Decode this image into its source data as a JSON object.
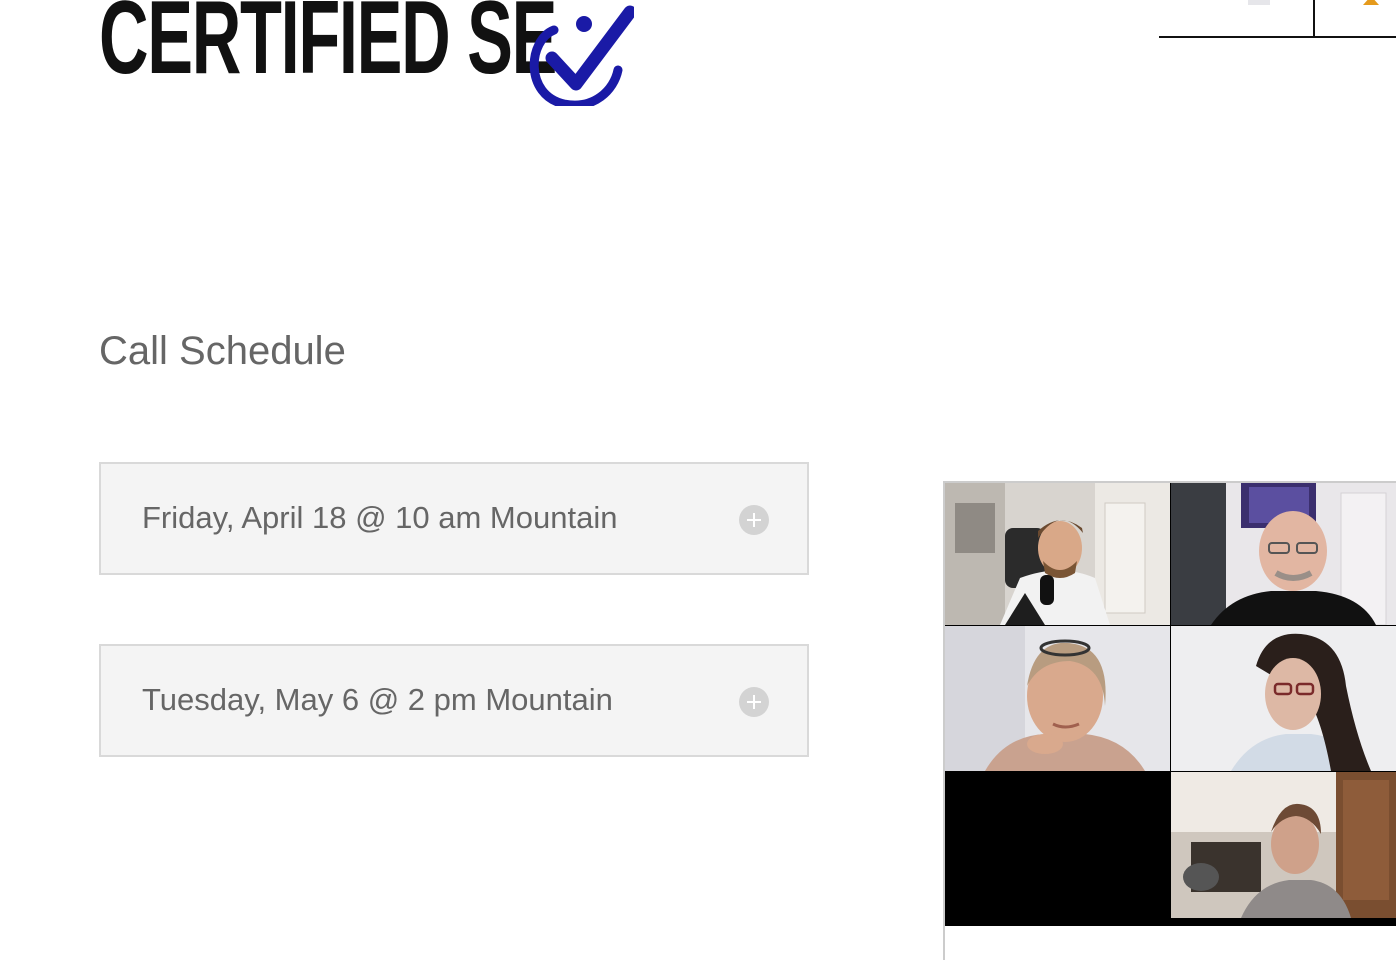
{
  "header": {
    "logo_text": "CERTIFIED SE",
    "logo_mark": "checkmark-logo-icon"
  },
  "nav": {
    "items": [
      {
        "icon": "flag-icon"
      },
      {
        "icon": "warning-icon"
      }
    ]
  },
  "page": {
    "title": "Call Schedule"
  },
  "schedule": {
    "items": [
      {
        "label": "Friday, April 18 @ 10 am Mountain",
        "icon": "plus-circle-icon"
      },
      {
        "label": "Tuesday, May 6 @ 2 pm Mountain",
        "icon": "plus-circle-icon"
      }
    ]
  },
  "video": {
    "tiles": 6
  },
  "colors": {
    "logo_blue": "#1a1aa6",
    "text_gray": "#666666",
    "accordion_bg": "#f4f4f4",
    "accordion_border": "#d9d9d9"
  }
}
